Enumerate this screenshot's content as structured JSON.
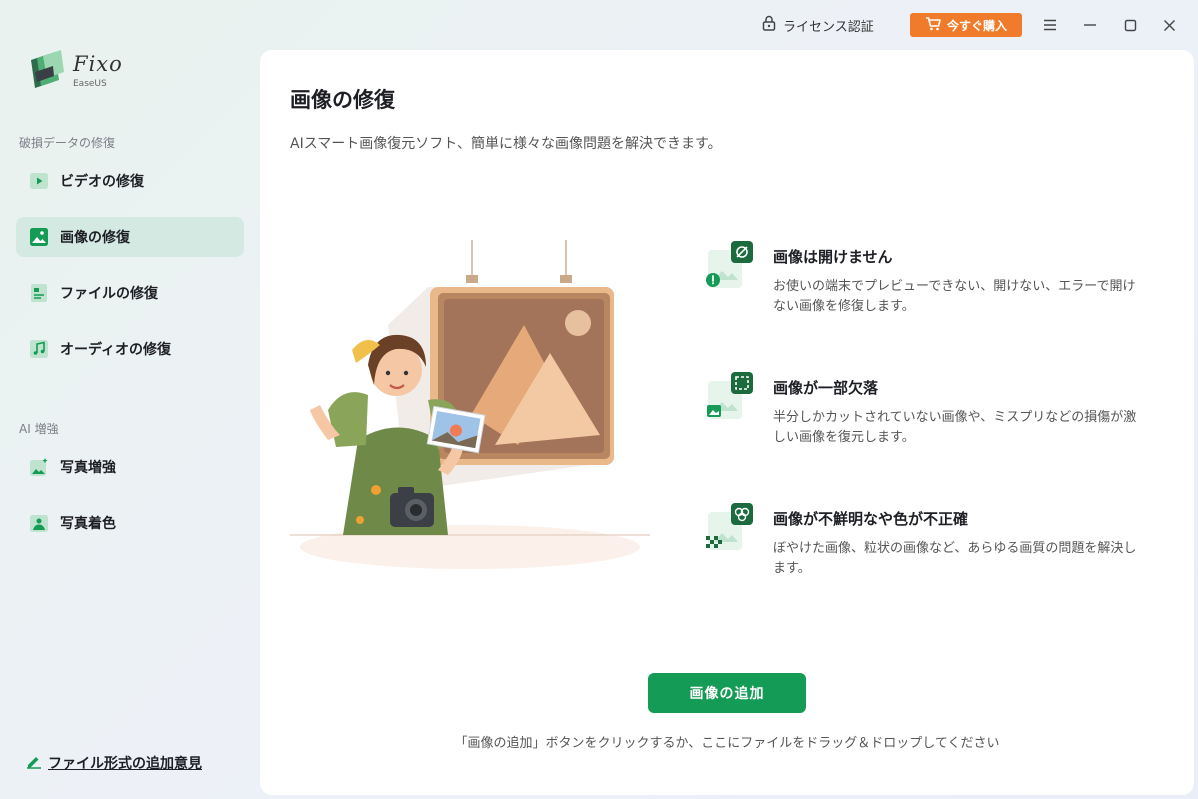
{
  "titlebar": {
    "license_label": "ライセンス認証",
    "buy_label": "今すぐ購入"
  },
  "logo": {
    "name": "Fixo",
    "sub": "EaseUS"
  },
  "sidebar": {
    "section_repair": "破損データの修復",
    "repair_items": [
      {
        "label": "ビデオの修復",
        "icon": "video-icon"
      },
      {
        "label": "画像の修復",
        "icon": "image-icon"
      },
      {
        "label": "ファイルの修復",
        "icon": "file-icon"
      },
      {
        "label": "オーディオの修復",
        "icon": "audio-icon"
      }
    ],
    "section_ai": "AI 増強",
    "ai_items": [
      {
        "label": "写真増強",
        "icon": "photo-enhance-icon"
      },
      {
        "label": "写真着色",
        "icon": "photo-colorize-icon"
      }
    ],
    "feedback_label": "ファイル形式の追加意見"
  },
  "main": {
    "title": "画像の修復",
    "description": "AIスマート画像復元ソフト、簡単に様々な画像問題を解決できます。",
    "features": [
      {
        "title": "画像は開けません",
        "desc": "お使いの端末でプレビューできない、開けない、エラーで開けない画像を修復します。",
        "icon": "broken-image-icon"
      },
      {
        "title": "画像が一部欠落",
        "desc": "半分しかカットされていない画像や、ミスプリなどの損傷が激しい画像を復元します。",
        "icon": "partial-image-icon"
      },
      {
        "title": "画像が不鮮明なや色が不正確",
        "desc": "ぼやけた画像、粒状の画像など、あらゆる画質の問題を解決します。",
        "icon": "blurry-image-icon"
      }
    ],
    "add_button": "画像の追加",
    "hint": "「画像の追加」ボタンをクリックするか、ここにファイルをドラッグ＆ドロップしてください"
  },
  "colors": {
    "accent": "#149b55",
    "buy": "#f07b2b",
    "active_nav": "#d4e9e2"
  }
}
